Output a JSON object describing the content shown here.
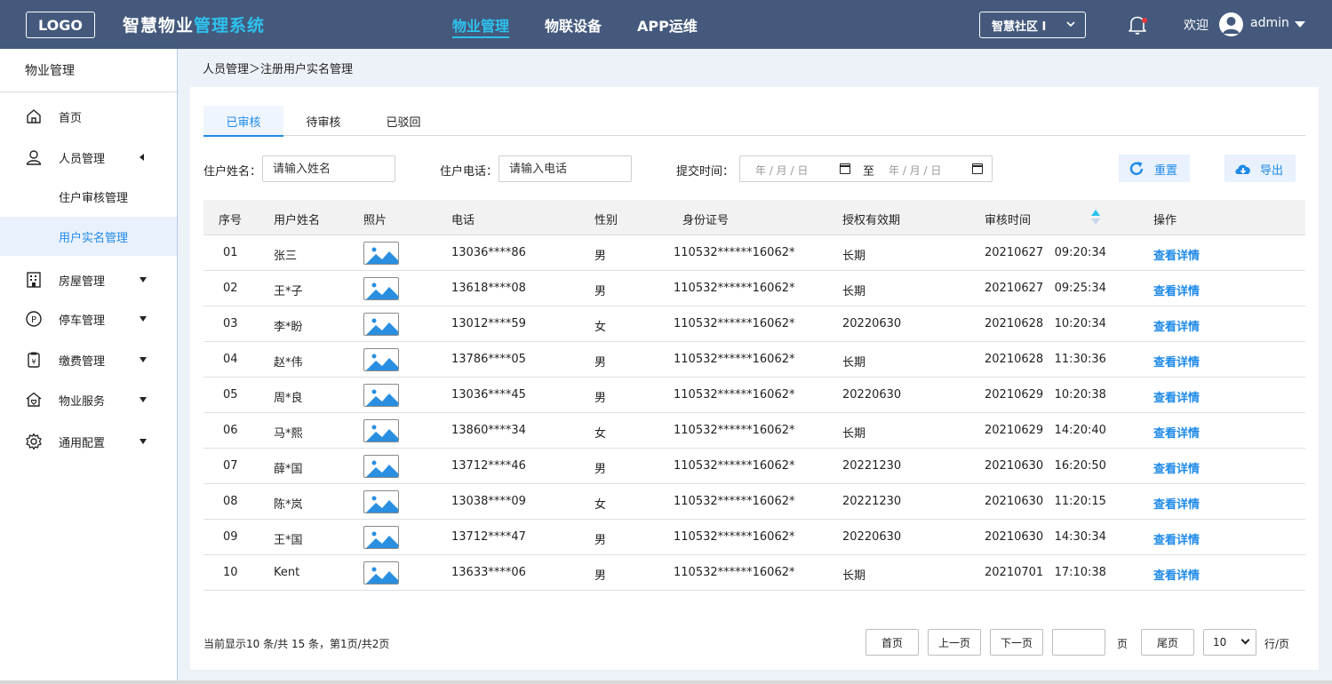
{
  "header": {
    "logo": "LOGO",
    "title_part1": "智慧物业",
    "title_part2": "管理系统",
    "nav": [
      {
        "label": "物业管理",
        "active": true
      },
      {
        "label": "物联设备",
        "active": false
      },
      {
        "label": "APP运维",
        "active": false
      }
    ],
    "community": "智慧社区 I",
    "welcome": "欢迎",
    "username": "admin"
  },
  "sidebar": {
    "section_title": "物业管理",
    "items": [
      {
        "label": "首页",
        "icon": "home-icon"
      },
      {
        "label": "人员管理",
        "icon": "user-icon"
      },
      {
        "label": "住户审核管理"
      },
      {
        "label": "用户实名管理"
      },
      {
        "label": "房屋管理",
        "icon": "building-icon"
      },
      {
        "label": "停车管理",
        "icon": "parking-icon"
      },
      {
        "label": "缴费管理",
        "icon": "payment-icon"
      },
      {
        "label": "物业服务",
        "icon": "service-icon"
      },
      {
        "label": "通用配置",
        "icon": "gear-icon"
      }
    ]
  },
  "breadcrumb": "人员管理＞注册用户实名管理",
  "tabs": [
    {
      "label": "已审核",
      "active": true
    },
    {
      "label": "待审核",
      "active": false
    },
    {
      "label": "已驳回",
      "active": false
    }
  ],
  "filters": {
    "name_label": "住户姓名：",
    "name_placeholder": "请输入姓名",
    "phone_label": "住户电话：",
    "phone_placeholder": "请输入电话",
    "time_label": "提交时间：",
    "date_placeholder": "年 / 月 / 日",
    "date_to": "至",
    "reset": "重置",
    "export": "导出"
  },
  "table": {
    "headers": [
      "序号",
      "用户姓名",
      "照片",
      "电话",
      "性别",
      "身份证号",
      "授权有效期",
      "审核时间",
      "操作"
    ],
    "rows": [
      {
        "no": "01",
        "name": "张三",
        "phone": "13036****86",
        "gender": "男",
        "id": "110532******16062*",
        "valid": "长期",
        "time": "20210627   09:20:34",
        "action": "查看详情"
      },
      {
        "no": "02",
        "name": "王*子",
        "phone": "13618****08",
        "gender": "男",
        "id": "110532******16062*",
        "valid": "长期",
        "time": "20210627   09:25:34",
        "action": "查看详情"
      },
      {
        "no": "03",
        "name": "李*盼",
        "phone": "13012****59",
        "gender": "女",
        "id": "110532******16062*",
        "valid": "20220630",
        "time": "20210628   10:20:34",
        "action": "查看详情"
      },
      {
        "no": "04",
        "name": "赵*伟",
        "phone": "13786****05",
        "gender": "男",
        "id": "110532******16062*",
        "valid": "长期",
        "time": "20210628   11:30:36",
        "action": "查看详情"
      },
      {
        "no": "05",
        "name": "周*良",
        "phone": "13036****45",
        "gender": "男",
        "id": "110532******16062*",
        "valid": "20220630",
        "time": "20210629   10:20:38",
        "action": "查看详情"
      },
      {
        "no": "06",
        "name": "马*熙",
        "phone": "13860****34",
        "gender": "女",
        "id": "110532******16062*",
        "valid": "长期",
        "time": "20210629   14:20:40",
        "action": "查看详情"
      },
      {
        "no": "07",
        "name": "薛*国",
        "phone": "13712****46",
        "gender": "男",
        "id": "110532******16062*",
        "valid": "20221230",
        "time": "20210630   16:20:50",
        "action": "查看详情"
      },
      {
        "no": "08",
        "name": "陈*岚",
        "phone": "13038****09",
        "gender": "女",
        "id": "110532******16062*",
        "valid": "20221230",
        "time": "20210630   11:20:15",
        "action": "查看详情"
      },
      {
        "no": "09",
        "name": "王*国",
        "phone": "13712****47",
        "gender": "男",
        "id": "110532******16062*",
        "valid": "20220630",
        "time": "20210630   14:30:34",
        "action": "查看详情"
      },
      {
        "no": "10",
        "name": "Kent",
        "phone": "13633****06",
        "gender": "男",
        "id": "110532******16062*",
        "valid": "长期",
        "time": "20210701   17:10:38",
        "action": "查看详情"
      }
    ]
  },
  "pagination": {
    "info": "当前显示10 条/共 15 条，第1页/共2页",
    "first": "首页",
    "prev": "上一页",
    "next": "下一页",
    "page_label": "页",
    "last": "尾页",
    "page_size": "10",
    "per_page_label": "行/页"
  },
  "colors": {
    "header_bg": "#44597c",
    "accent": "#2dc2ee",
    "link": "#1f8ae8"
  }
}
